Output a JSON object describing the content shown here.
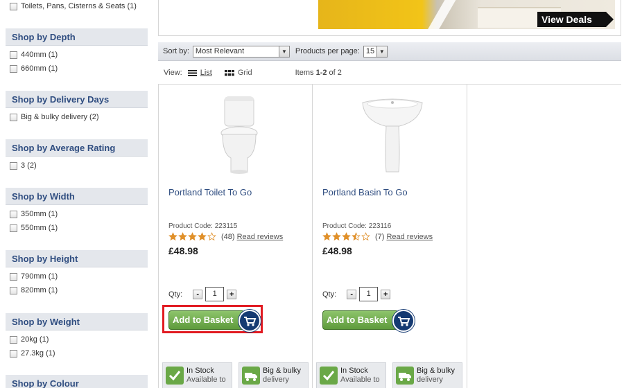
{
  "sidebar": {
    "top_option": "Toilets, Pans, Cisterns & Seats (1)",
    "groups": [
      {
        "title": "Shop by Depth",
        "options": [
          "440mm (1)",
          "660mm (1)"
        ]
      },
      {
        "title": "Shop by Delivery Days",
        "options": [
          "Big & bulky delivery (2)"
        ]
      },
      {
        "title": "Shop by Average Rating",
        "options": [
          "3 (2)"
        ]
      },
      {
        "title": "Shop by Width",
        "options": [
          "350mm (1)",
          "550mm (1)"
        ]
      },
      {
        "title": "Shop by Height",
        "options": [
          "790mm (1)",
          "820mm (1)"
        ]
      },
      {
        "title": "Shop by Weight",
        "options": [
          "20kg (1)",
          "27.3kg (1)"
        ]
      },
      {
        "title": "Shop by Colour",
        "options": []
      }
    ]
  },
  "banner": {
    "cta": "View Deals"
  },
  "toolbar": {
    "sort_label": "Sort by:",
    "sort_value": "Most Relevant",
    "per_page_label": "Products per page:",
    "per_page_value": "15",
    "view_label": "View:",
    "list_label": "List",
    "grid_label": "Grid",
    "items_prefix": "Items ",
    "items_range": "1",
    "items_dash": "-",
    "items_end": "2",
    "items_suffix": " of 2"
  },
  "products": [
    {
      "name": "Portland Toilet To Go",
      "code": "Product Code: 223115",
      "rating": 4,
      "review_count": "(48)",
      "reviews_link": "Read reviews",
      "price": "£48.98",
      "qty_label": "Qty:",
      "qty": "1",
      "add_label": "Add to Basket",
      "stock_title": "In Stock",
      "stock_sub": "Available to",
      "delivery_title": "Big & bulky",
      "delivery_sub": "delivery"
    },
    {
      "name": "Portland Basin To Go",
      "code": "Product Code: 223116",
      "rating": 3.5,
      "review_count": "(7)",
      "reviews_link": "Read reviews",
      "price": "£48.98",
      "qty_label": "Qty:",
      "qty": "1",
      "add_label": "Add to Basket",
      "stock_title": "In Stock",
      "stock_sub": "Available to",
      "delivery_title": "Big & bulky",
      "delivery_sub": "delivery"
    }
  ],
  "qty_minus": "-",
  "qty_plus": "+",
  "colors": {
    "facet_title": "#2f4d80",
    "add_button": "#6aa847",
    "cart_circle": "#153a72",
    "highlight": "#e11b22",
    "star": "#e0902a"
  }
}
